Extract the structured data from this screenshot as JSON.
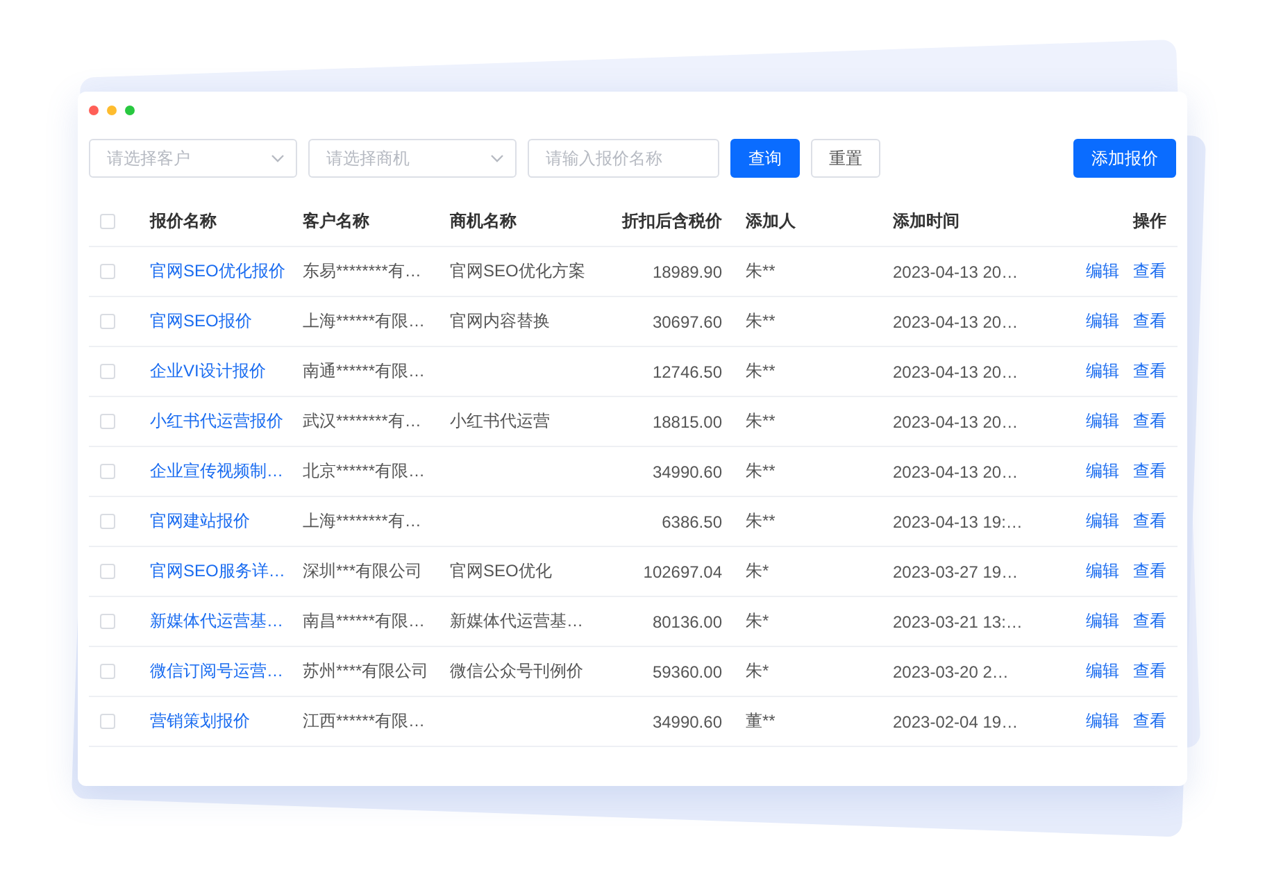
{
  "filters": {
    "customer": {
      "placeholder": "请选择客户"
    },
    "opportunity": {
      "placeholder": "请选择商机"
    },
    "quote_name": {
      "placeholder": "请输入报价名称"
    },
    "buttons": [
      {
        "label": "查询",
        "kind": "primary"
      },
      {
        "label": "重置",
        "kind": "default"
      }
    ],
    "add_button": "添加报价"
  },
  "table": {
    "select_all": {
      "checked": false
    },
    "columns": [
      "报价名称",
      "客户名称",
      "商机名称",
      "折扣后含税价",
      "添加人",
      "添加时间",
      "操作"
    ],
    "rows": [
      {
        "checked": false,
        "name": "官网SEO优化报价",
        "customer": "东易********有…",
        "opportunity": "官网SEO优化方案",
        "price": "18989.90",
        "adder": "朱**",
        "time": "2023-04-13 20…",
        "actions": [
          "编辑",
          "查看"
        ]
      },
      {
        "checked": false,
        "name": "官网SEO报价",
        "customer": "上海******有限…",
        "opportunity": "官网内容替换",
        "price": "30697.60",
        "adder": "朱**",
        "time": "2023-04-13 20…",
        "actions": [
          "编辑",
          "查看"
        ]
      },
      {
        "checked": false,
        "name": "企业VI设计报价",
        "customer": "南通******有限…",
        "opportunity": "",
        "price": "12746.50",
        "adder": "朱**",
        "time": "2023-04-13 20…",
        "actions": [
          "编辑",
          "查看"
        ]
      },
      {
        "checked": false,
        "name": "小红书代运营报价",
        "customer": "武汉********有…",
        "opportunity": "小红书代运营",
        "price": "18815.00",
        "adder": "朱**",
        "time": "2023-04-13 20…",
        "actions": [
          "编辑",
          "查看"
        ]
      },
      {
        "checked": false,
        "name": "企业宣传视频制…",
        "customer": "北京******有限…",
        "opportunity": "",
        "price": "34990.60",
        "adder": "朱**",
        "time": "2023-04-13 20…",
        "actions": [
          "编辑",
          "查看"
        ]
      },
      {
        "checked": false,
        "name": "官网建站报价",
        "customer": "上海********有…",
        "opportunity": "",
        "price": "6386.50",
        "adder": "朱**",
        "time": "2023-04-13 19:…",
        "actions": [
          "编辑",
          "查看"
        ]
      },
      {
        "checked": false,
        "name": "官网SEO服务详…",
        "customer": "深圳***有限公司",
        "opportunity": "官网SEO优化",
        "price": "102697.04",
        "adder": "朱*",
        "time": "2023-03-27 19…",
        "actions": [
          "编辑",
          "查看"
        ]
      },
      {
        "checked": false,
        "name": "新媒体代运营基…",
        "customer": "南昌******有限…",
        "opportunity": "新媒体代运营基…",
        "price": "80136.00",
        "adder": "朱*",
        "time": "2023-03-21 13:…",
        "actions": [
          "编辑",
          "查看"
        ]
      },
      {
        "checked": false,
        "name": "微信订阅号运营…",
        "customer": "苏州****有限公司",
        "opportunity": "微信公众号刊例价",
        "price": "59360.00",
        "adder": "朱*",
        "time": "2023-03-20 2…",
        "actions": [
          "编辑",
          "查看"
        ]
      },
      {
        "checked": false,
        "name": "营销策划报价",
        "customer": "江西******有限…",
        "opportunity": "",
        "price": "34990.60",
        "adder": "董**",
        "time": "2023-02-04 19…",
        "actions": [
          "编辑",
          "查看"
        ]
      }
    ]
  }
}
